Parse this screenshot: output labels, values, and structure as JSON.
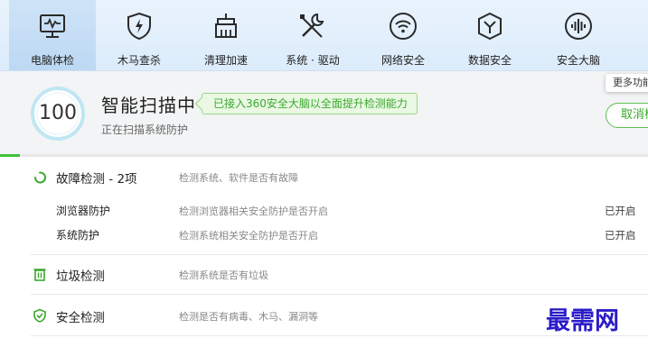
{
  "nav": {
    "items": [
      {
        "label": "电脑体检",
        "icon": "pc-monitor-icon",
        "active": true
      },
      {
        "label": "木马查杀",
        "icon": "shield-bolt-icon"
      },
      {
        "label": "清理加速",
        "icon": "broom-icon"
      },
      {
        "label": "系统 · 驱动",
        "icon": "wrench-screwdriver-icon"
      },
      {
        "label": "网络安全",
        "icon": "wifi-icon"
      },
      {
        "label": "数据安全",
        "icon": "shield-check-icon"
      },
      {
        "label": "安全大脑",
        "icon": "brain-waveform-icon"
      }
    ]
  },
  "scan": {
    "score": "100",
    "title": "智能扫描中",
    "promo": "已接入360安全大脑以全面提升检测能力",
    "status": "正在扫描系统防护",
    "progress": 0.03
  },
  "more_features": "更多功能",
  "cancel_label": "取消检测",
  "checks": {
    "fault": {
      "title": "故障检测 - 2项",
      "desc": "检测系统、软件是否有故障",
      "icon": "loading-spinner-icon",
      "items": [
        {
          "name": "浏览器防护",
          "desc": "检测浏览器相关安全防护是否开启",
          "status": "已开启"
        },
        {
          "name": "系统防护",
          "desc": "检测系统相关安全防护是否开启",
          "status": "已开启"
        }
      ]
    },
    "junk": {
      "title": "垃圾检测",
      "desc": "检测系统是否有垃圾",
      "icon": "trash-icon"
    },
    "security": {
      "title": "安全检测",
      "desc": "检测是否有病毒、木马、漏洞等",
      "icon": "shield-check-icon"
    }
  },
  "watermark": "最需网",
  "colors": {
    "accent_green": "#3aa92e",
    "nav_bg": "#e1eefb",
    "watermark_blue": "#2b1cc8"
  }
}
